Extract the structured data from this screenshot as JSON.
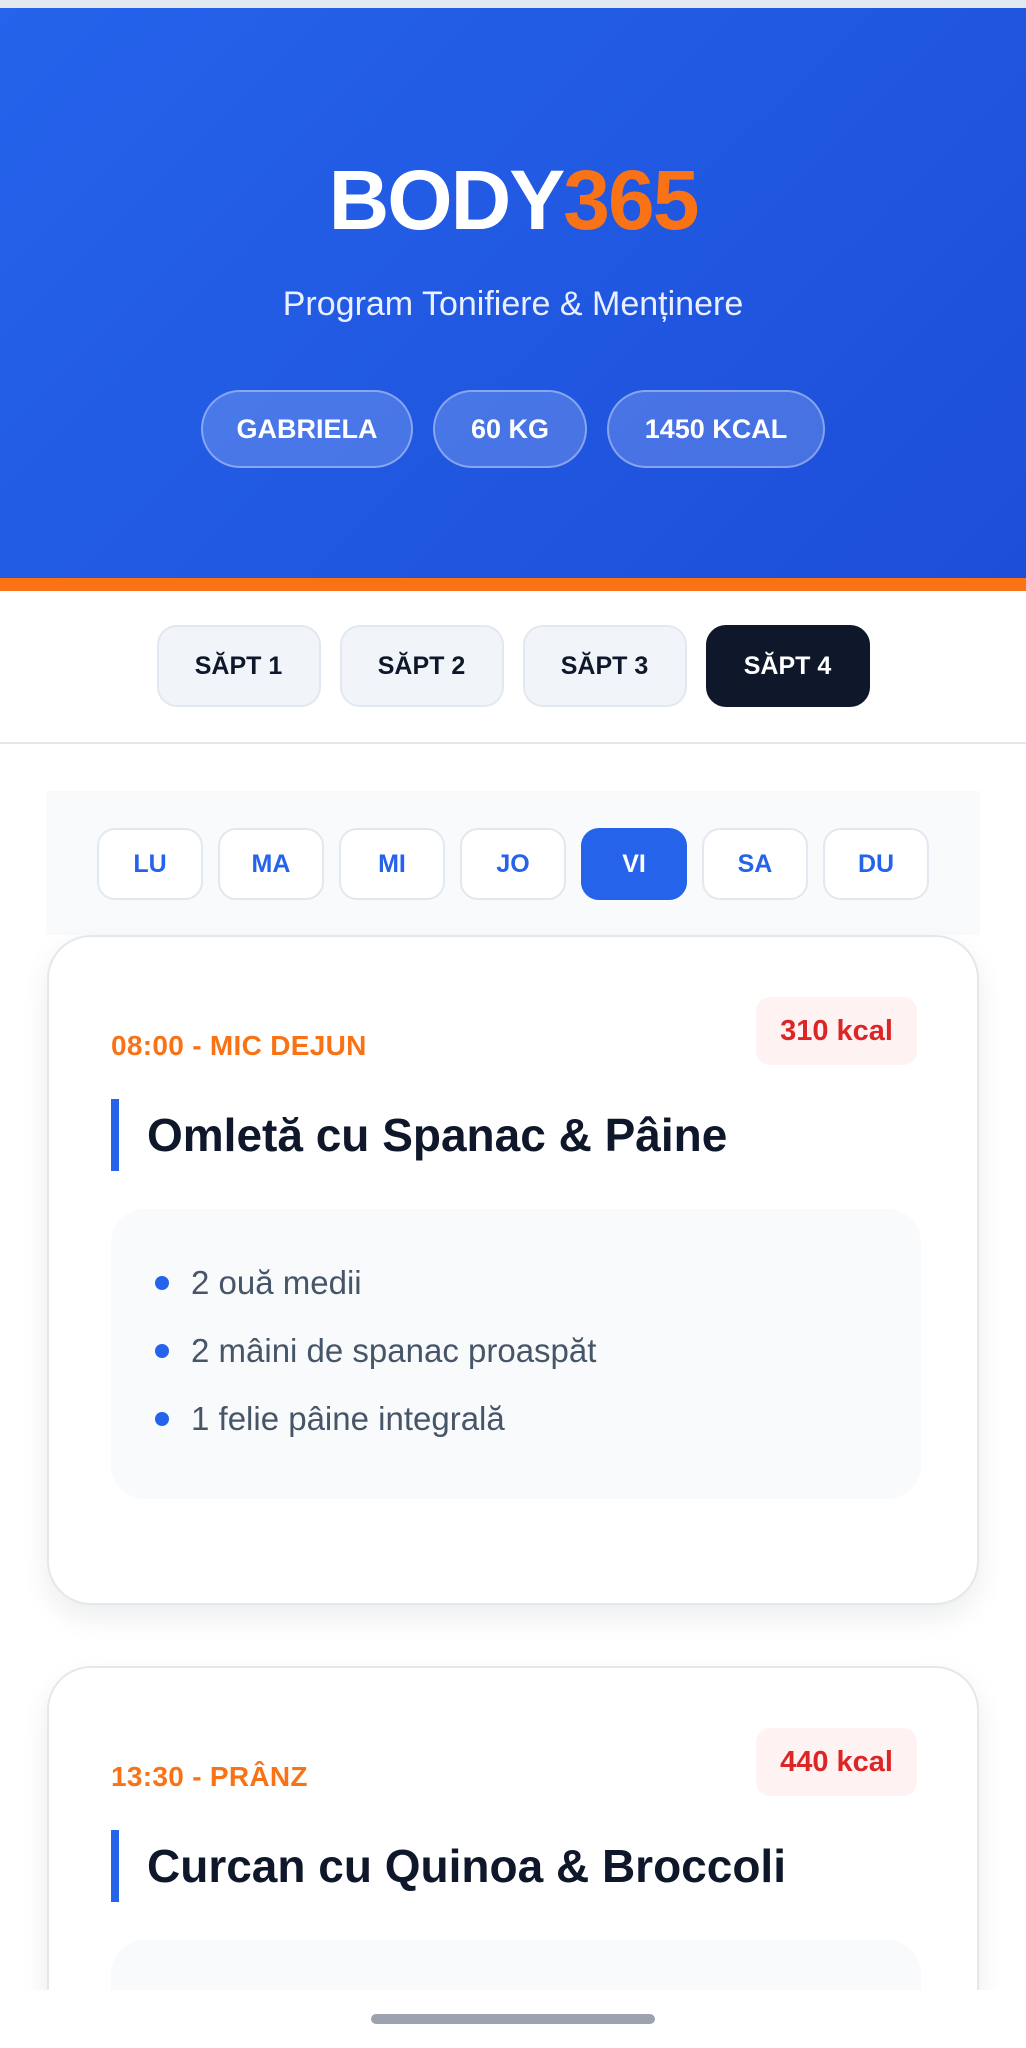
{
  "brand": {
    "part1": "BODY",
    "part2": "365",
    "accent_color": "#f97316",
    "primary_color": "#2563eb"
  },
  "subtitle": "Program Tonifiere & Menținere",
  "profile": {
    "name": "GABRIELA",
    "weight": "60 KG",
    "calories": "1450 KCAL"
  },
  "weeks": [
    "SĂPT 1",
    "SĂPT 2",
    "SĂPT 3",
    "SĂPT 4"
  ],
  "active_week": "SĂPT 4",
  "days": [
    "LU",
    "MA",
    "MI",
    "JO",
    "VI",
    "SA",
    "DU"
  ],
  "active_day": "VI",
  "meals": [
    {
      "time": "08:00 - MIC DEJUN",
      "kcal": "310 kcal",
      "title": "Omletă cu Spanac & Pâine",
      "ingredients": [
        "2 ouă medii",
        "2 mâini de spanac proaspăt",
        "1 felie pâine integrală"
      ]
    },
    {
      "time": "13:30 - PRÂNZ",
      "kcal": "440 kcal",
      "title": "Curcan cu Quinoa & Broccoli",
      "ingredients": []
    }
  ]
}
